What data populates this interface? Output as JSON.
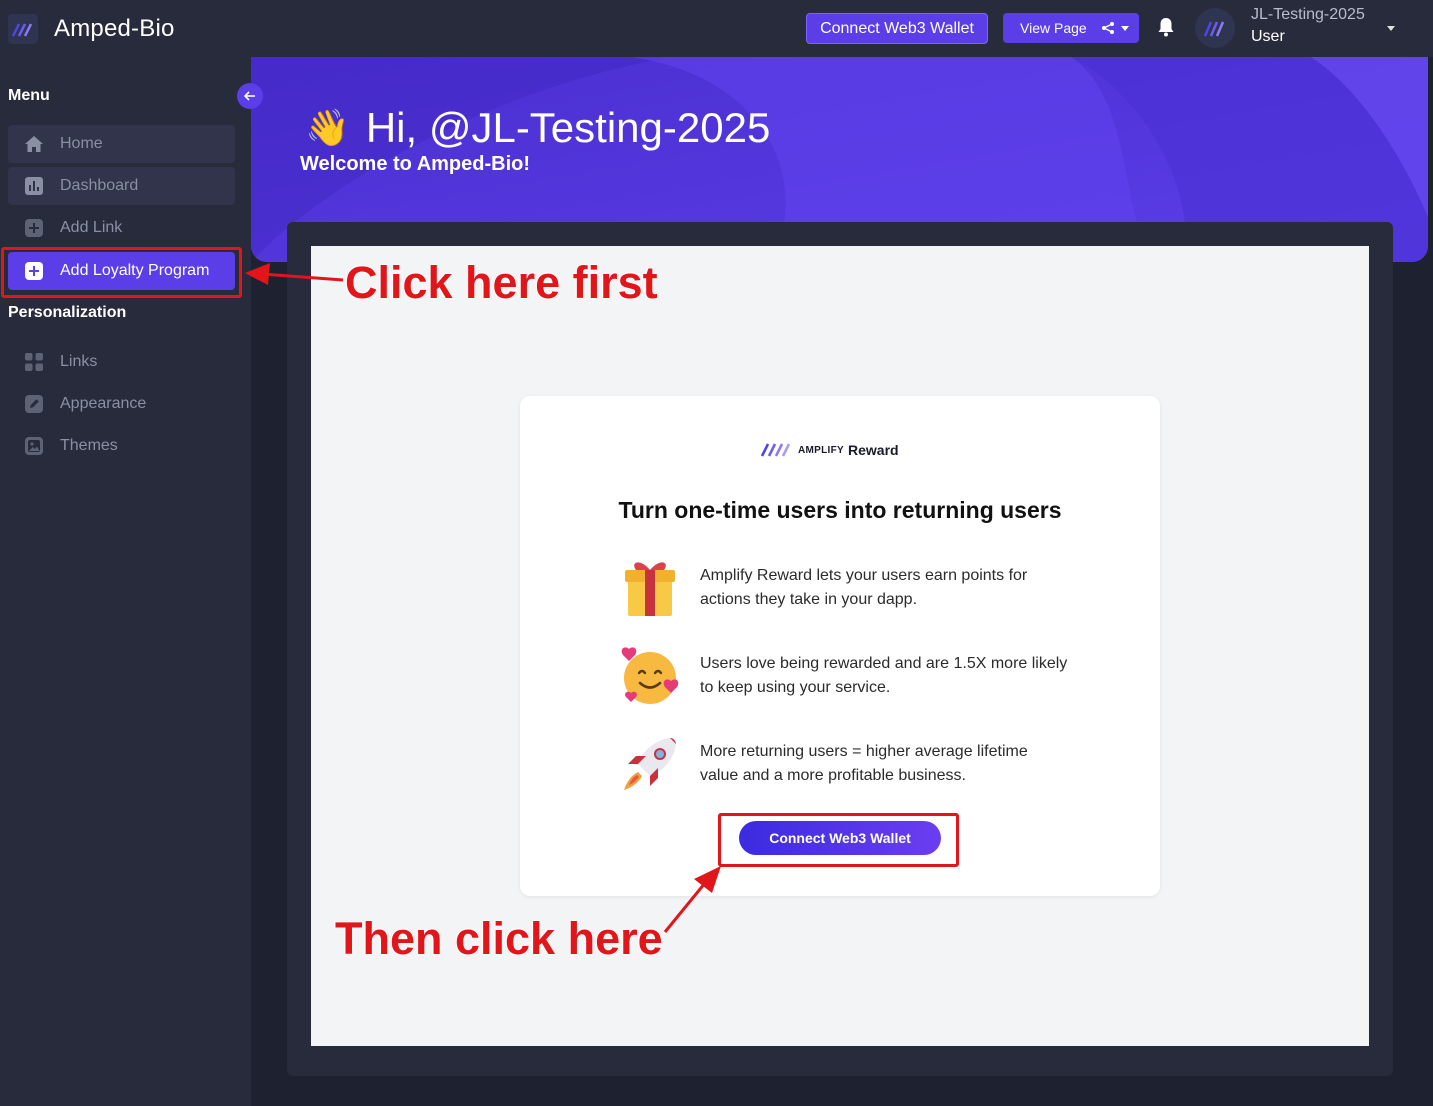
{
  "brand": {
    "name": "Amped-Bio",
    "logo_icon": "amped-logo-icon"
  },
  "header": {
    "connect_wallet_label": "Connect Web3 Wallet",
    "view_page_label": "View Page",
    "user_name": "JL-Testing-2025",
    "user_role": "User"
  },
  "sidebar": {
    "menu_title": "Menu",
    "menu_items": [
      {
        "label": "Home",
        "icon": "home-icon"
      },
      {
        "label": "Dashboard",
        "icon": "chart-icon"
      },
      {
        "label": "Add Link",
        "icon": "plus-square-icon"
      },
      {
        "label": "Add Loyalty Program",
        "icon": "plus-square-icon",
        "active": true
      }
    ],
    "personalization_title": "Personalization",
    "personalization_items": [
      {
        "label": "Links",
        "icon": "grid-icon"
      },
      {
        "label": "Appearance",
        "icon": "edit-icon"
      },
      {
        "label": "Themes",
        "icon": "image-icon"
      }
    ]
  },
  "hero": {
    "greeting": "Hi, @JL-Testing-2025",
    "welcome": "Welcome to Amped-Bio!"
  },
  "card": {
    "logo_amplify": "AMPLIFY",
    "logo_reward": "Reward",
    "title": "Turn one-time users into returning users",
    "features": [
      {
        "text": "Amplify Reward lets your users earn points for actions they take in your dapp.",
        "icon": "gift-icon"
      },
      {
        "text": "Users love being rewarded and are 1.5X more likely to keep using your service.",
        "icon": "smiling-hearts-icon"
      },
      {
        "text": "More returning users = higher average lifetime value and a more profitable business.",
        "icon": "rocket-icon"
      }
    ],
    "button_label": "Connect Web3 Wallet"
  },
  "annotations": {
    "first": "Click here first",
    "then": "Then click here",
    "color": "#e0161b"
  },
  "colors": {
    "accent": "#5b3ee8",
    "sidebar_bg": "#282b3c",
    "page_bg": "#1e2130"
  }
}
